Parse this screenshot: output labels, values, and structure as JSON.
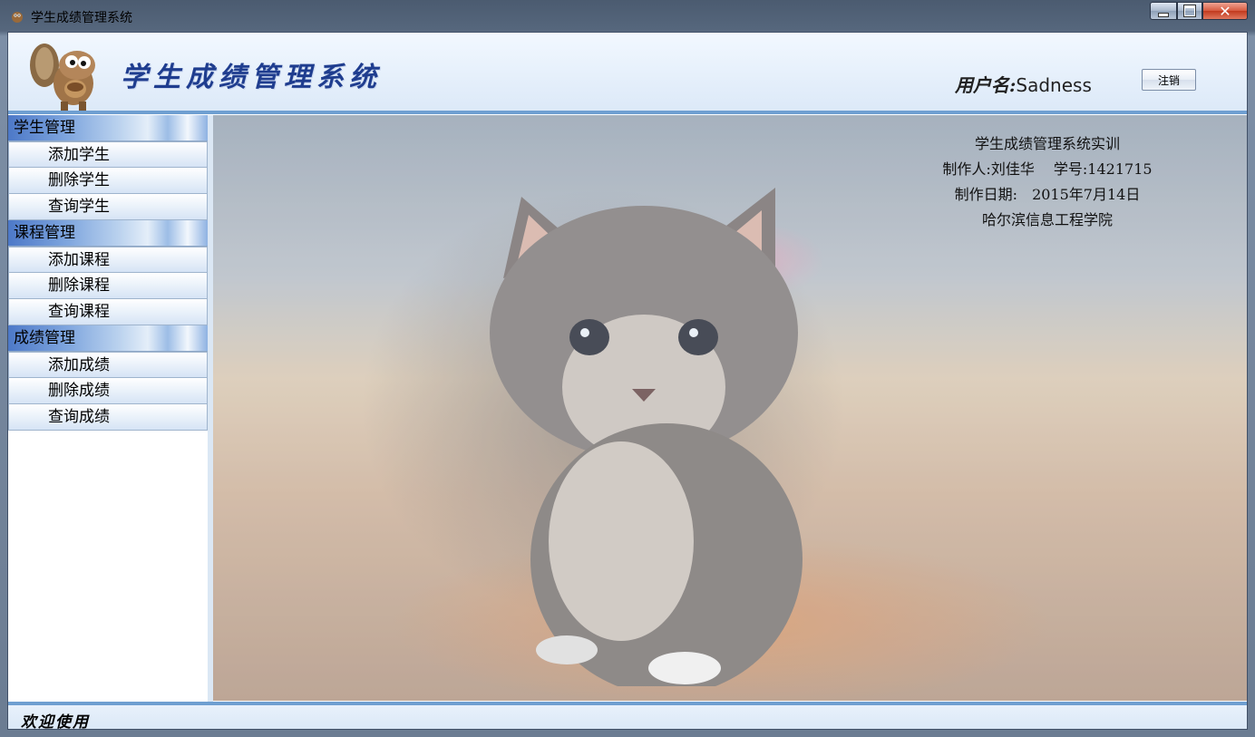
{
  "window": {
    "title": "学生成绩管理系统"
  },
  "header": {
    "app_title": "学生成绩管理系统",
    "user_label": "用户名:",
    "user_name": "Sadness",
    "logout_label": "注销"
  },
  "nav": {
    "groups": [
      {
        "label": "学生管理",
        "items": [
          "添加学生",
          "删除学生",
          "查询学生"
        ]
      },
      {
        "label": "课程管理",
        "items": [
          "添加课程",
          "删除课程",
          "查询课程"
        ]
      },
      {
        "label": "成绩管理",
        "items": [
          "添加成绩",
          "删除成绩",
          "查询成绩"
        ]
      }
    ]
  },
  "info": {
    "line1": "学生成绩管理系统实训",
    "line2": "制作人:刘佳华　 学号:1421715",
    "line3": "制作日期:　2015年7月14日",
    "line4": "哈尔滨信息工程学院"
  },
  "status": {
    "text": "欢迎使用"
  },
  "colors": {
    "accent": "#6f9fd1",
    "title_blue": "#1f3d8f"
  }
}
